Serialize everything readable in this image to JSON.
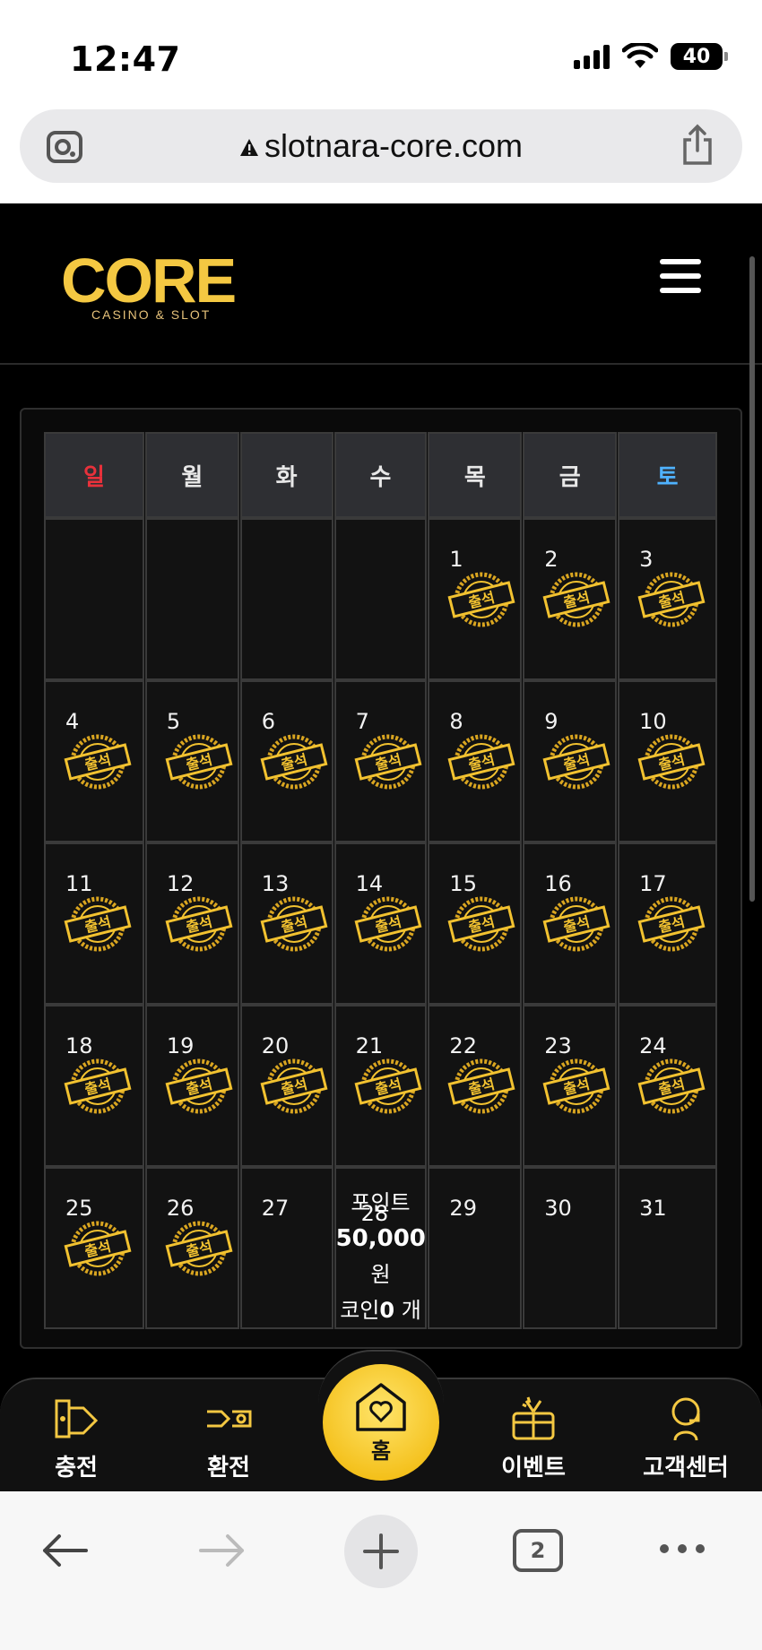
{
  "status_bar": {
    "time": "12:47",
    "battery": "40"
  },
  "browser": {
    "url": "slotnara-core.com"
  },
  "site": {
    "logo_text": "CORE",
    "logo_sub": "CASINO & SLOT"
  },
  "calendar": {
    "weekdays": [
      "일",
      "월",
      "화",
      "수",
      "목",
      "금",
      "토"
    ],
    "stamp_label": "출석",
    "weeks": [
      [
        null,
        null,
        null,
        null,
        {
          "day": "1",
          "checked": true
        },
        {
          "day": "2",
          "checked": true
        },
        {
          "day": "3",
          "checked": true
        }
      ],
      [
        {
          "day": "4",
          "checked": true
        },
        {
          "day": "5",
          "checked": true
        },
        {
          "day": "6",
          "checked": true
        },
        {
          "day": "7",
          "checked": true
        },
        {
          "day": "8",
          "checked": true
        },
        {
          "day": "9",
          "checked": true
        },
        {
          "day": "10",
          "checked": true
        }
      ],
      [
        {
          "day": "11",
          "checked": true
        },
        {
          "day": "12",
          "checked": true
        },
        {
          "day": "13",
          "checked": true
        },
        {
          "day": "14",
          "checked": true
        },
        {
          "day": "15",
          "checked": true
        },
        {
          "day": "16",
          "checked": true
        },
        {
          "day": "17",
          "checked": true
        }
      ],
      [
        {
          "day": "18",
          "checked": true
        },
        {
          "day": "19",
          "checked": true
        },
        {
          "day": "20",
          "checked": true
        },
        {
          "day": "21",
          "checked": true
        },
        {
          "day": "22",
          "checked": true
        },
        {
          "day": "23",
          "checked": true
        },
        {
          "day": "24",
          "checked": true
        }
      ],
      [
        {
          "day": "25",
          "checked": true
        },
        {
          "day": "26",
          "checked": true
        },
        {
          "day": "27",
          "checked": false
        },
        {
          "day": "28",
          "checked": false,
          "today": true
        },
        {
          "day": "29",
          "checked": false
        },
        {
          "day": "30",
          "checked": false
        },
        {
          "day": "31",
          "checked": false
        }
      ]
    ],
    "today_info": {
      "points_label": "포인트",
      "points_value": "50,000",
      "points_unit": "원",
      "coin_label": "코인",
      "coin_value": "0",
      "coin_unit": " 개"
    }
  },
  "bottom_nav": {
    "deposit": "충전",
    "withdraw": "환전",
    "home": "홈",
    "event": "이벤트",
    "support": "고객센터"
  },
  "safari": {
    "tabs_count": "2"
  },
  "colors": {
    "accent_gold": "#f4c842",
    "sunday": "#e8313b",
    "saturday": "#4fb2ff"
  }
}
